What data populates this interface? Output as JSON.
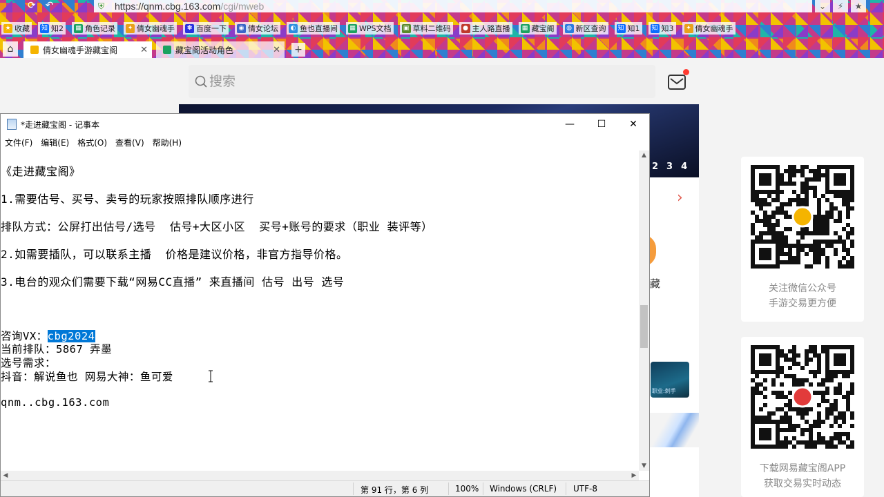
{
  "browser": {
    "url_host": "https://qnm.cbg.163.com",
    "url_path": "/cgi/mweb",
    "bookmarks": [
      "收藏",
      "知2",
      "角色记录",
      "倩女幽魂手",
      "百度一下",
      "倩女论坛",
      "鱼也直播间",
      "WPS文档",
      "草料二维码",
      "主人路直播",
      "藏宝阁",
      "新区查询",
      "知1",
      "知3",
      "倩女幽魂手"
    ],
    "tabs": [
      {
        "label": "倩女幽魂手游藏宝阁",
        "active": true
      },
      {
        "label": "藏宝阁活动角色",
        "active": false
      }
    ]
  },
  "webpage": {
    "search_placeholder": "搜索",
    "banner_pages": [
      "2",
      "3",
      "4"
    ],
    "side_char": "藏",
    "card_label": "职业:刺手",
    "qr1_caption": [
      "关注微信公众号",
      "手游交易更方便"
    ],
    "qr2_caption": [
      "下载网易藏宝阁APP",
      "获取交易实时动态"
    ],
    "colors": {
      "accent_red": "#e25a4e",
      "orange": "#f59c3c",
      "selection": "#0078d7"
    }
  },
  "notepad": {
    "title": "*走进藏宝阁 - 记事本",
    "menus": [
      "文件(F)",
      "编辑(E)",
      "格式(O)",
      "查看(V)",
      "帮助(H)"
    ],
    "lines": {
      "l1": "《走进藏宝阁》",
      "l2": "1.需要估号、买号、卖号的玩家按照排队顺序进行",
      "l3": "排队方式：公屏打出估号/选号  估号+大区小区  买号+账号的要求（职业 装评等）",
      "l4": "2.如需要插队，可以联系主播  价格是建议价格，非官方指导价格。",
      "l5": "3.电台的观众们需要下载“网易CC直播” 来直播间 估号 出号 选号",
      "l6_prefix": "咨询VX：",
      "l6_selected": "cbg2024",
      "l7": "当前排队：5867 弄墨",
      "l8": "选号需求：",
      "l9": "抖音：解说鱼也 网易大神：鱼可爱",
      "l10": "qnm..cbg.163.com"
    },
    "status": {
      "position": "第 91 行，第 6 列",
      "zoom": "100%",
      "line_ending": "Windows (CRLF)",
      "encoding": "UTF-8"
    }
  }
}
